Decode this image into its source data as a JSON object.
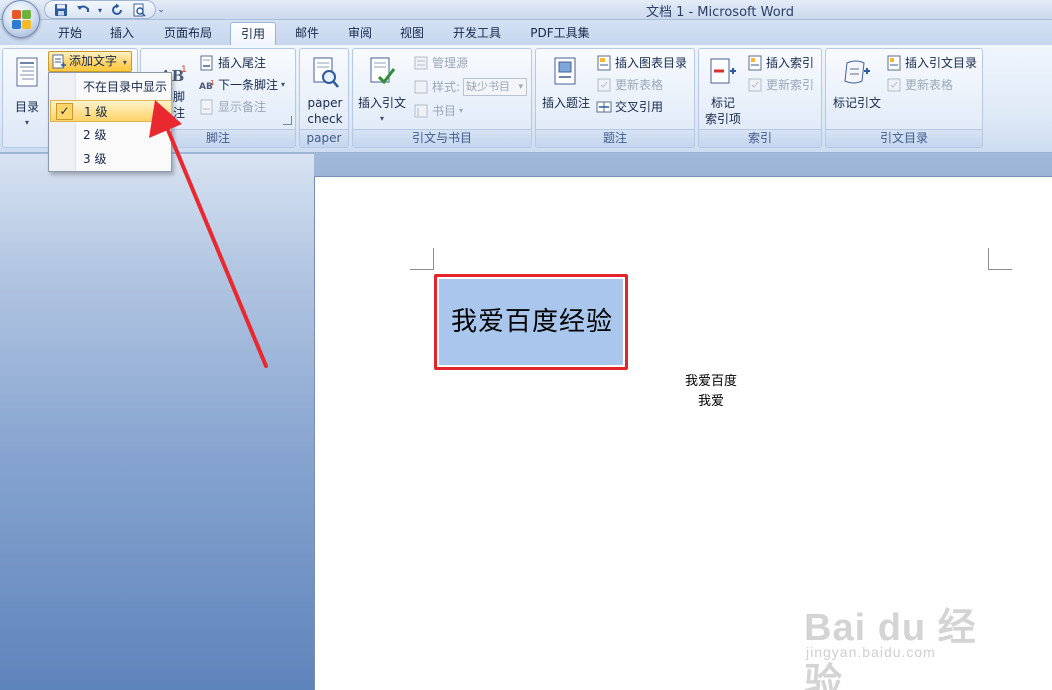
{
  "window": {
    "title": "文档 1 - Microsoft Word"
  },
  "tabs": [
    "开始",
    "插入",
    "页面布局",
    "引用",
    "邮件",
    "审阅",
    "视图",
    "开发工具",
    "PDF工具集"
  ],
  "active_tab": "引用",
  "ribbon": {
    "toc": {
      "label": "目录",
      "add_text": "添加文字"
    },
    "footnote": {
      "insert_footnote_partial": "脚注",
      "insert_endnote": "插入尾注",
      "next_footnote": "下一条脚注",
      "show_notes": "显示备注",
      "group": "脚注"
    },
    "paper": {
      "label_line1": "paper",
      "label_line2": "check",
      "group": "paper"
    },
    "citations": {
      "insert_citation": "插入引文",
      "manage_sources": "管理源",
      "style_label": "样式:",
      "style_value": "缺少书目",
      "bibliography": "书目",
      "group": "引文与书目"
    },
    "captions": {
      "insert_caption": "插入题注",
      "insert_table_of_figures": "插入图表目录",
      "update_table": "更新表格",
      "cross_reference": "交叉引用",
      "group": "题注"
    },
    "index": {
      "mark_entry_line1": "标记",
      "mark_entry_line2": "索引项",
      "insert_index": "插入索引",
      "update_index": "更新索引",
      "group": "索引"
    },
    "toa": {
      "mark_citation": "标记引文",
      "insert_toa": "插入引文目录",
      "update_table": "更新表格",
      "group": "引文目录"
    }
  },
  "dropdown": {
    "items": [
      "不在目录中显示",
      "1 级",
      "2 级",
      "3 级"
    ],
    "checked": "✓"
  },
  "document": {
    "heading": "我爱百度经验",
    "line1": "我爱百度",
    "line2": "我爱"
  },
  "watermark": {
    "main": "Bai du 经验",
    "sub": "jingyan.baidu.com"
  },
  "colors": {
    "highlight_box": "#e3242b",
    "selection": "#a9c7ec",
    "arrow": "#e8292f",
    "menu_hover": "#ffd56a"
  }
}
